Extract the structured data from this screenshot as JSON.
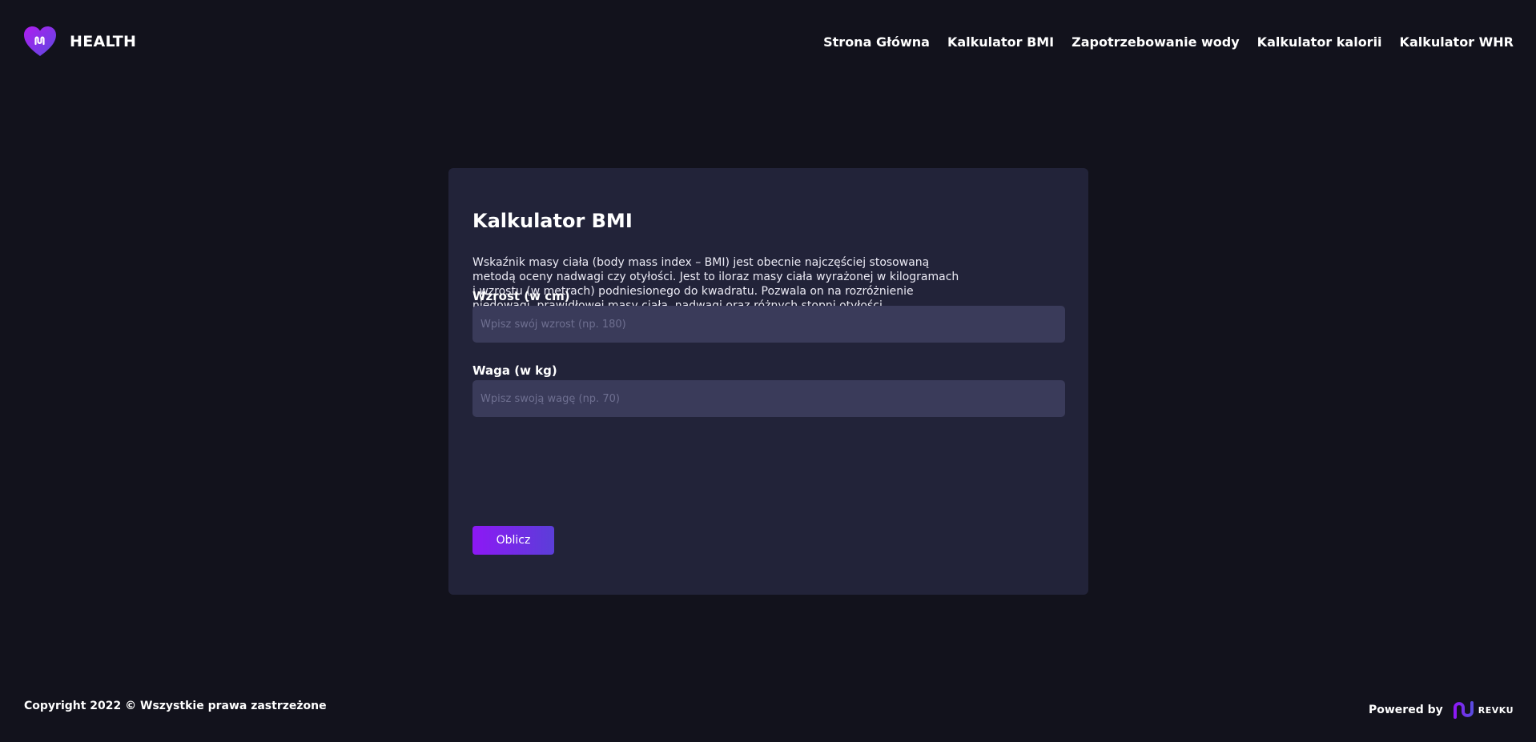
{
  "brand": {
    "name": "HEALTH",
    "accent_from": "#a21cf2",
    "accent_to": "#5b4be0"
  },
  "nav": {
    "items": [
      {
        "label": "Strona Główna"
      },
      {
        "label": "Kalkulator BMI"
      },
      {
        "label": "Zapotrzebowanie wody"
      },
      {
        "label": "Kalkulator kalorii"
      },
      {
        "label": "Kalkulator WHR"
      }
    ]
  },
  "card": {
    "title": "Kalkulator BMI",
    "description": "Wskaźnik masy ciała (body mass index – BMI) jest obecnie najczęściej stosowaną metodą oceny nadwagi czy otyłości. Jest to iloraz masy ciała wyrażonej w kilogramach i wzrostu (w metrach) podniesionego do kwadratu. Pozwala on na rozróżnienie niedowagi, prawidłowej masy ciała, nadwagi oraz różnych stopni otyłości.",
    "height_field": {
      "label": "Wzrost (w cm)",
      "placeholder": "Wpisz swój wzrost (np. 180)",
      "value": ""
    },
    "weight_field": {
      "label": "Waga (w kg)",
      "placeholder": "Wpisz swoją wagę (np. 70)",
      "value": ""
    },
    "submit_label": "Oblicz"
  },
  "footer": {
    "copyright": "Copyright 2022 © Wszystkie prawa zastrzeżone",
    "powered_by": "Powered by",
    "powered_brand": "REVKU"
  },
  "colors": {
    "background": "#12121c",
    "card": "#222339",
    "input": "#3a3b5a",
    "button_from": "#8d18f5",
    "button_to": "#5b3ed8"
  },
  "icons": {
    "logo": "heart-logo-icon",
    "revku": "revku-logo-icon"
  }
}
